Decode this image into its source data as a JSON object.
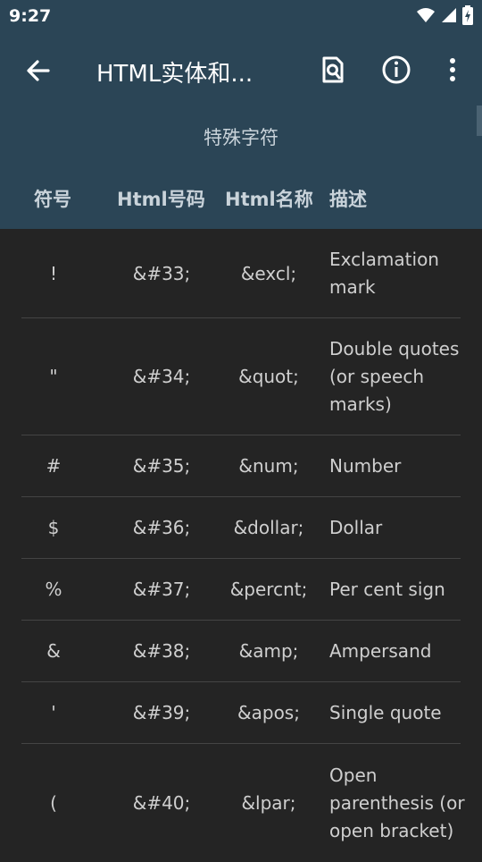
{
  "status": {
    "time": "9:27"
  },
  "toolbar": {
    "title": "HTML实体和..."
  },
  "section": {
    "title": "特殊字符"
  },
  "columns": [
    "符号",
    "Html号码",
    "Html名称",
    "描述"
  ],
  "rows": [
    {
      "symbol": "!",
      "number": "&#33;",
      "name": "&excl;",
      "description": "Exclamation mark"
    },
    {
      "symbol": "\"",
      "number": "&#34;",
      "name": "&quot;",
      "description": "Double quotes (or speech marks)"
    },
    {
      "symbol": "#",
      "number": "&#35;",
      "name": "&num;",
      "description": "Number"
    },
    {
      "symbol": "$",
      "number": "&#36;",
      "name": "&dollar;",
      "description": "Dollar"
    },
    {
      "symbol": "%",
      "number": "&#37;",
      "name": "&percnt;",
      "description": "Per cent sign"
    },
    {
      "symbol": "&",
      "number": "&#38;",
      "name": "&amp;",
      "description": "Ampersand"
    },
    {
      "symbol": "'",
      "number": "&#39;",
      "name": "&apos;",
      "description": "Single quote"
    },
    {
      "symbol": "(",
      "number": "&#40;",
      "name": "&lpar;",
      "description": "Open parenthesis (or open bracket)"
    }
  ],
  "icons": {
    "back": "arrow-back-icon",
    "search": "document-search-icon",
    "info": "info-icon",
    "more": "more-vertical-icon",
    "wifi": "wifi-icon",
    "signal": "cell-signal-icon",
    "battery": "battery-charging-icon"
  },
  "colors": {
    "header": "#2b4556",
    "background": "#242424"
  }
}
